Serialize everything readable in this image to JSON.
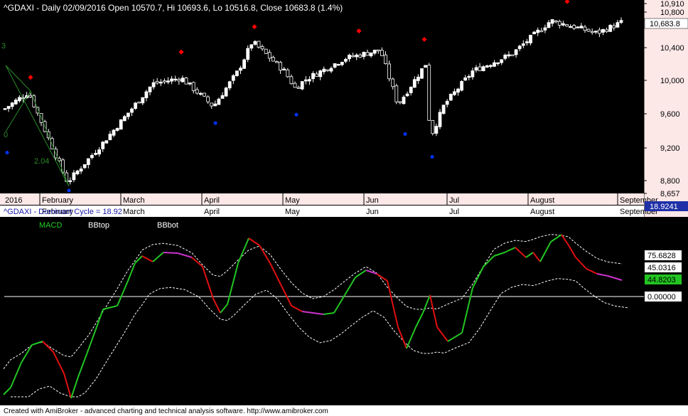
{
  "upper": {
    "title": "^GDAXI - Daily 02/09/2016 Open 10570.7, Hi 10693.6, Lo 10516.8, Close 10683.8 (1.4%)",
    "price_ticks": [
      "10,910",
      "10,800",
      "10,400",
      "10,000",
      "9,600",
      "9,200",
      "8,800",
      "8,657"
    ],
    "last_price": "10,683.8",
    "wave_labels": [
      "3",
      "2.04",
      "0"
    ],
    "months": [
      "2016",
      "February",
      "March",
      "April",
      "May",
      "Jun",
      "Jul",
      "August",
      "September"
    ]
  },
  "lower": {
    "title": "^GDAXI - Dominant Cycle = 18.92",
    "title_value": "18.9241",
    "months": [
      "February",
      "March",
      "April",
      "May",
      "Jun",
      "Jul",
      "August",
      "September"
    ],
    "legend": {
      "macd": "MACD",
      "bbtop": "BBtop",
      "bbbot": "BBbot"
    },
    "value_labels": {
      "bbtop": "75.6828",
      "middle": "45.0316",
      "macd": "44.8203",
      "zero": "0.00000"
    }
  },
  "footer": "Created with AmiBroker - advanced charting and technical analysis software. http://www.amibroker.com",
  "colors": {
    "background": "#000000",
    "up": "#ffffff",
    "down": "#000000",
    "macd_up": "#22c522",
    "macd_mid": "#cc33cc",
    "macd_down": "#e01010",
    "peak": "#ff0000",
    "trough": "#0033ff",
    "label_bg": "#ffffff",
    "legend_green": "#22cc22"
  },
  "chart_data": [
    {
      "type": "candlestick",
      "title": "^GDAXI - Daily 02/09/2016 Open 10570.7, Hi 10693.6, Lo 10516.8, Close 10683.8 (1.4%)",
      "ylim": [
        8657,
        10910
      ],
      "y_ticks": [
        10800,
        10400,
        10000,
        9600,
        9200,
        8800
      ],
      "last_close": 10683.8,
      "close_path": [
        {
          "m": "Jan end",
          "v": 9650
        },
        {
          "m": "Feb",
          "v": 9850
        },
        {
          "m": "Feb",
          "v": 8780
        },
        {
          "m": "Mar",
          "v": 9250
        },
        {
          "m": "Mar",
          "v": 9950
        },
        {
          "m": "Apr",
          "v": 10020
        },
        {
          "m": "Apr",
          "v": 9680
        },
        {
          "m": "Apr",
          "v": 10100
        },
        {
          "m": "Apr end",
          "v": 10450
        },
        {
          "m": "May",
          "v": 10100
        },
        {
          "m": "May",
          "v": 9900
        },
        {
          "m": "May",
          "v": 10000
        },
        {
          "m": "Jun",
          "v": 10250
        },
        {
          "m": "Jun",
          "v": 10350
        },
        {
          "m": "Jun",
          "v": 9700
        },
        {
          "m": "Jun",
          "v": 10200
        },
        {
          "m": "Jul",
          "v": 9300
        },
        {
          "m": "Jul",
          "v": 9700
        },
        {
          "m": "Jul",
          "v": 10100
        },
        {
          "m": "Aug",
          "v": 10300
        },
        {
          "m": "Aug",
          "v": 10700
        },
        {
          "m": "Aug end",
          "v": 10550
        },
        {
          "m": "Sep",
          "v": 10683.8
        }
      ],
      "peaks": [
        9950,
        10250,
        10550,
        10500,
        10400,
        10850
      ],
      "troughs": [
        9200,
        8700,
        9550,
        9650,
        9420,
        9150
      ]
    },
    {
      "type": "line",
      "title": "^GDAXI - Dominant Cycle = 18.92",
      "series": [
        {
          "name": "MACD",
          "last": 44.8203
        },
        {
          "name": "BBtop",
          "last": 75.6828
        },
        {
          "name": "BBbot"
        }
      ],
      "reference_lines": [
        0
      ],
      "value_labels": [
        75.6828,
        45.0316,
        44.8203,
        0.0
      ]
    }
  ]
}
